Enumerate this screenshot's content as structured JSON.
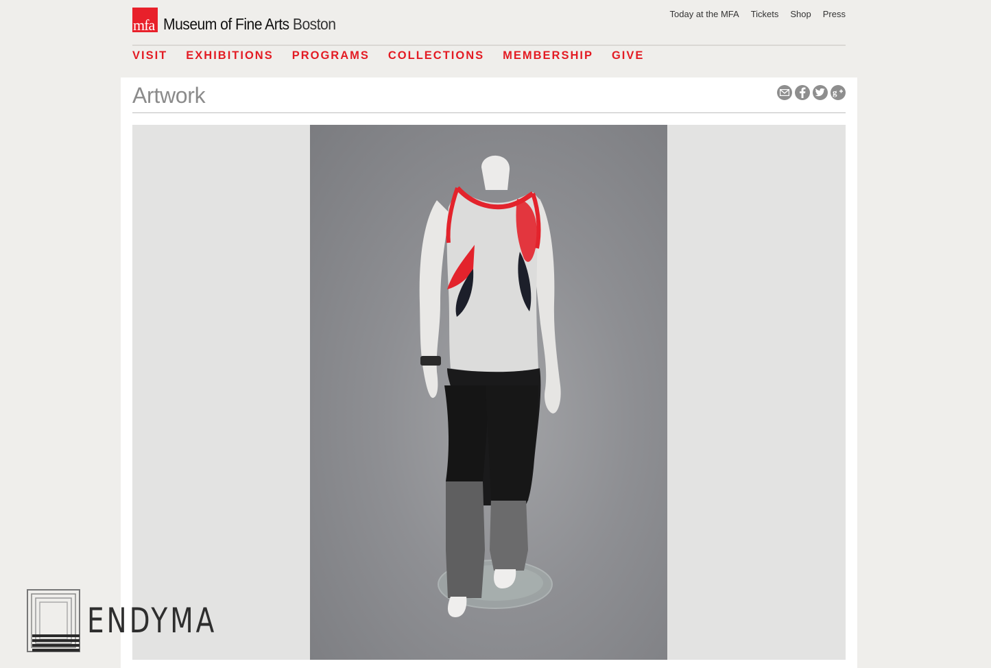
{
  "header": {
    "logo_mark": "mfa",
    "logo_title": "Museum of Fine Arts",
    "logo_city": "Boston",
    "utility_links": [
      "Today at the MFA",
      "Tickets",
      "Shop",
      "Press"
    ],
    "main_nav": [
      "VISIT",
      "EXHIBITIONS",
      "PROGRAMS",
      "COLLECTIONS",
      "MEMBERSHIP",
      "GIVE"
    ]
  },
  "content": {
    "page_title": "Artwork",
    "share_icons": [
      "email-icon",
      "facebook-icon",
      "twitter-icon",
      "google-plus-icon"
    ],
    "image_subject": "mannequin-outfit-photo"
  },
  "watermark": {
    "text": "ENDYMA"
  },
  "colors": {
    "brand_red": "#e31b23",
    "page_bg": "#efeeeb",
    "panel_bg": "#ffffff",
    "title_gray": "#8b8b8b"
  }
}
